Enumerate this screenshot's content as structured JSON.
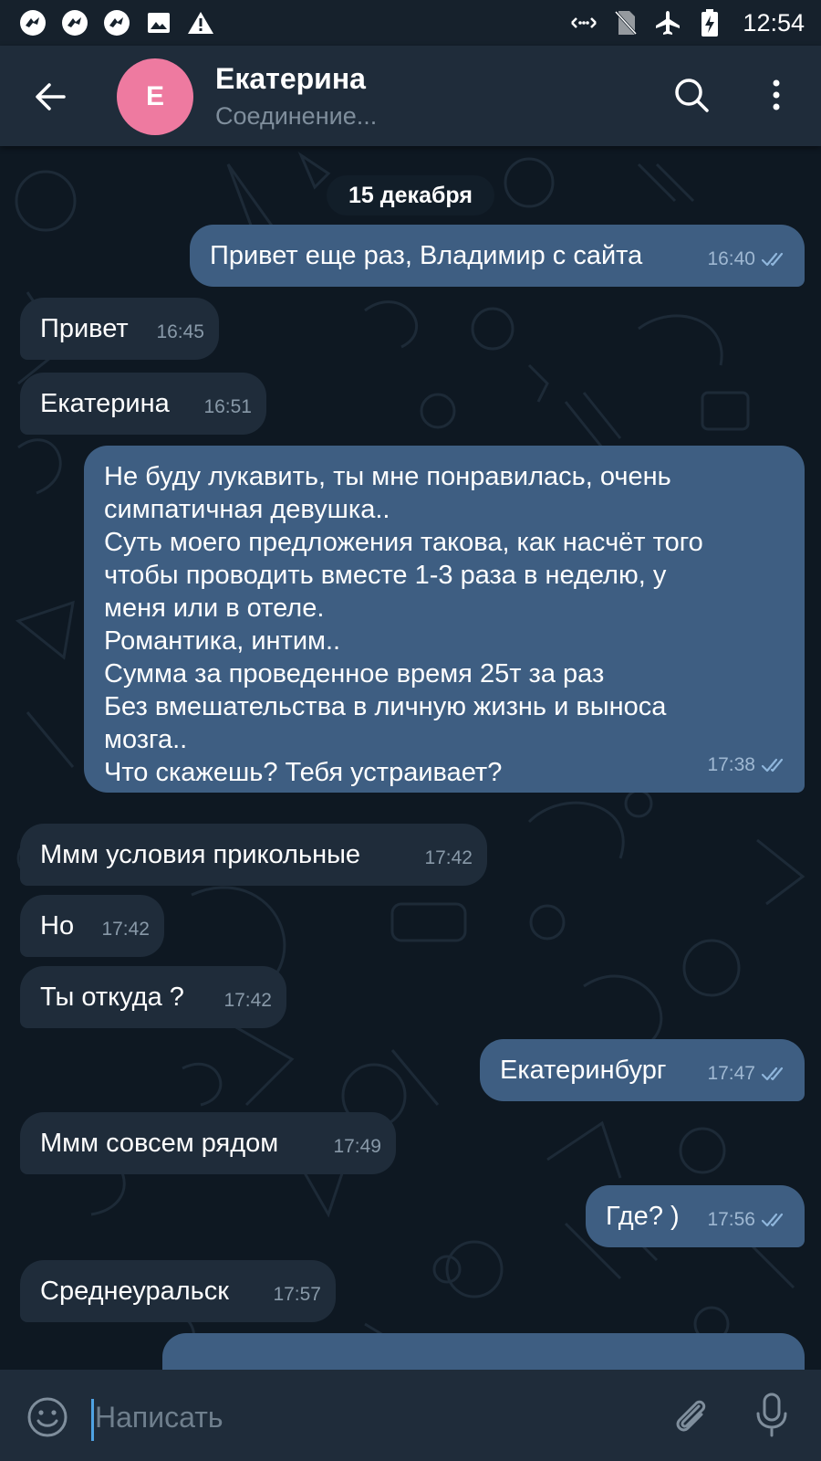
{
  "status_bar": {
    "time": "12:54"
  },
  "header": {
    "avatar_letter": "Е",
    "avatar_color": "#ee7aa0",
    "contact_name": "Екатерина",
    "contact_status": "Соединение..."
  },
  "chat": {
    "date_separator": "15 декабря",
    "messages": [
      {
        "direction": "out",
        "text": "Привет еще раз, Владимир с сайта",
        "time": "16:40",
        "read": true
      },
      {
        "direction": "in",
        "text": "Привет",
        "time": "16:45"
      },
      {
        "direction": "in",
        "text": "Екатерина",
        "time": "16:51"
      },
      {
        "direction": "out",
        "text": "Не буду лукавить, ты мне понравилась, очень\nсимпатичная девушка..\nСуть моего предложения такова, как насчёт того\nчтобы проводить вместе 1-3 раза в неделю, у\nменя или в отеле.\nРомантика, интим..\nСумма за проведенное время 25т за раз\nБез вмешательства в личную жизнь и выноса\nмозга..\nЧто скажешь? Тебя устраивает?",
        "time": "17:38",
        "read": true
      },
      {
        "direction": "in",
        "text": "Ммм условия прикольные",
        "time": "17:42"
      },
      {
        "direction": "in",
        "text": "Но",
        "time": "17:42"
      },
      {
        "direction": "in",
        "text": "Ты откуда ?",
        "time": "17:42"
      },
      {
        "direction": "out",
        "text": "Екатеринбург",
        "time": "17:47",
        "read": true
      },
      {
        "direction": "in",
        "text": "Ммм совсем рядом",
        "time": "17:49"
      },
      {
        "direction": "out",
        "text": "Где? )",
        "time": "17:56",
        "read": true
      },
      {
        "direction": "in",
        "text": "Среднеуральск",
        "time": "17:57"
      }
    ]
  },
  "composer": {
    "placeholder": "Написать"
  },
  "colors": {
    "incoming_bubble": "#1f2c3a",
    "outgoing_bubble": "#3e5e82",
    "header": "#1f2c3a",
    "accent": "#4fa3e3"
  }
}
